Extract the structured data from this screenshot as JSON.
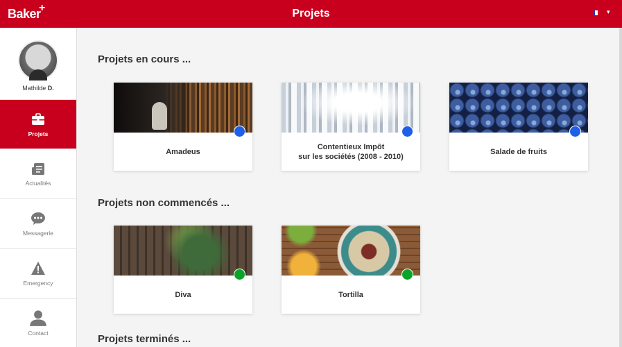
{
  "header": {
    "logo": "Baker",
    "logo_plus": "+",
    "title": "Projets",
    "language_caret": "▾"
  },
  "user": {
    "first_name": "Mathilde",
    "last_initial": "D."
  },
  "sidebar": {
    "items": [
      {
        "label": "Projets",
        "icon": "briefcase-icon",
        "active": true
      },
      {
        "label": "Actualités",
        "icon": "newspaper-icon",
        "active": false
      },
      {
        "label": "Messagerie",
        "icon": "chat-bubble-icon",
        "active": false
      },
      {
        "label": "Emergency",
        "icon": "warning-icon",
        "active": false
      },
      {
        "label": "Contact",
        "icon": "person-icon",
        "active": false
      }
    ]
  },
  "sections": [
    {
      "title": "Projets en cours ...",
      "cards": [
        {
          "title": "Amadeus",
          "image": "library",
          "status": "blue"
        },
        {
          "title": "Contentieux Impôt\nsur les sociétés (2008 - 2010)",
          "image": "columns",
          "status": "blue"
        },
        {
          "title": "Salade de fruits",
          "image": "blueberry",
          "status": "blue"
        }
      ]
    },
    {
      "title": "Projets non commencés ...",
      "cards": [
        {
          "title": "Diva",
          "image": "wood",
          "status": "green"
        },
        {
          "title": "Tortilla",
          "image": "food",
          "status": "green"
        }
      ]
    },
    {
      "title": "Projets terminés ...",
      "cards": []
    }
  ],
  "colors": {
    "brand": "#c8001e",
    "status_blue": "#2060e8",
    "status_green": "#0aa528"
  }
}
